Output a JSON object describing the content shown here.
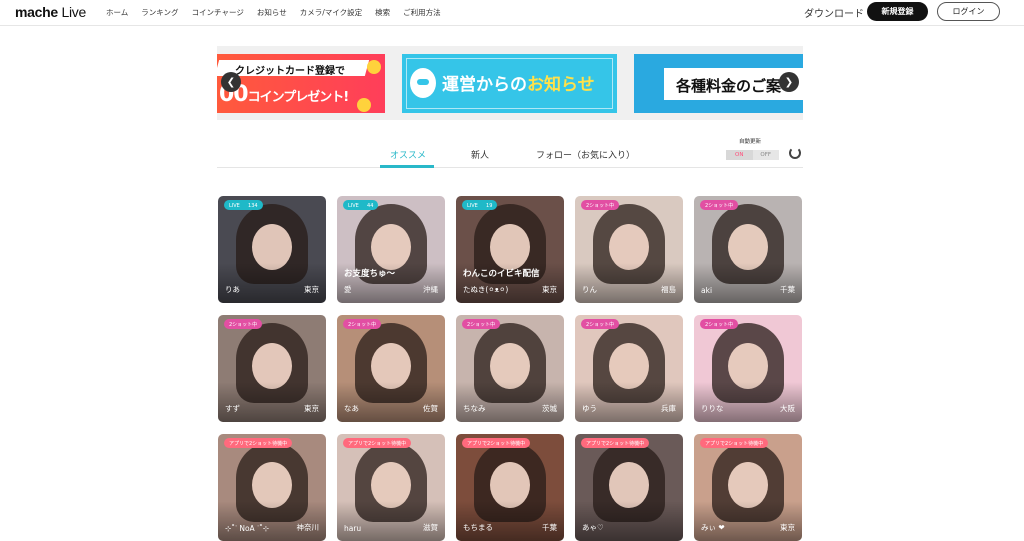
{
  "header": {
    "logo_main": "mache",
    "logo_sub": "Live",
    "nav": [
      "ホーム",
      "ランキング",
      "コインチャージ",
      "お知らせ",
      "カメラ/マイク設定",
      "検索",
      "ご利用方法"
    ],
    "download": "ダウンロード",
    "signup": "新規登録",
    "login": "ログイン"
  },
  "banners": {
    "b1_line1": "クレジットカード登録で",
    "b1_line2a": "00",
    "b1_line2b": "コインプレゼント!",
    "b2_a": "運営からの",
    "b2_b": "お知らせ",
    "b3": "各種料金のご案"
  },
  "tabs": {
    "recommend": "オススメ",
    "new": "新人",
    "follow": "フォロー（お気に入り）",
    "auto_label": "自動更新",
    "on": "ON",
    "off": "OFF"
  },
  "cards": [
    {
      "name": "りあ",
      "area": "東京",
      "badge": "LIVE 　 134",
      "type": "live",
      "title": "",
      "bg": "#4a4a52"
    },
    {
      "name": "愛",
      "area": "沖縄",
      "badge": "LIVE 　 44",
      "type": "live",
      "title": "お支度ちゅ〜",
      "bg": "#cdbfc4"
    },
    {
      "name": "たぬき(⚪︎ᴥ⚪︎)",
      "area": "東京",
      "badge": "LIVE 　 19",
      "type": "live",
      "title": "わんこのイビキ配信",
      "bg": "#6b5049"
    },
    {
      "name": "りん",
      "area": "福島",
      "badge": "2ショット中",
      "type": "2shot",
      "title": "",
      "bg": "#d9c9c0"
    },
    {
      "name": "aki",
      "area": "千葉",
      "badge": "2ショット中",
      "type": "2shot",
      "title": "",
      "bg": "#b9b3b2"
    },
    {
      "name": "すず",
      "area": "東京",
      "badge": "2ショット中",
      "type": "2shot",
      "title": "",
      "bg": "#8e7c74"
    },
    {
      "name": "なあ",
      "area": "佐賀",
      "badge": "2ショット中",
      "type": "2shot",
      "title": "",
      "bg": "#b68f78"
    },
    {
      "name": "ちなみ",
      "area": "茨城",
      "badge": "2ショット中",
      "type": "2shot",
      "title": "",
      "bg": "#c7b4ad"
    },
    {
      "name": "ゆう",
      "area": "兵庫",
      "badge": "2ショット中",
      "type": "2shot",
      "title": "",
      "bg": "#e0c7bd"
    },
    {
      "name": "りりな",
      "area": "大阪",
      "badge": "2ショット中",
      "type": "2shot",
      "title": "",
      "bg": "#f0c8d5"
    },
    {
      "name": "⊹˚ᐝ NoA ᐝ˚⊹",
      "area": "神奈川",
      "badge": "アプリで2ショット待機中",
      "type": "app",
      "title": "",
      "bg": "#a88a7e"
    },
    {
      "name": "haru",
      "area": "滋賀",
      "badge": "アプリで2ショット待機中",
      "type": "app",
      "title": "",
      "bg": "#d5c0b8"
    },
    {
      "name": "もちまる",
      "area": "千葉",
      "badge": "アプリで2ショット待機中",
      "type": "app",
      "title": "",
      "bg": "#7d4d3c"
    },
    {
      "name": "あゃ♡",
      "area": "",
      "badge": "アプリで2ショット待機中",
      "type": "app",
      "title": "",
      "bg": "#6a5a58"
    },
    {
      "name": "みぃ ❤",
      "area": "東京",
      "badge": "アプリで2ショット待機中",
      "type": "app",
      "title": "",
      "bg": "#c9a08c"
    }
  ]
}
